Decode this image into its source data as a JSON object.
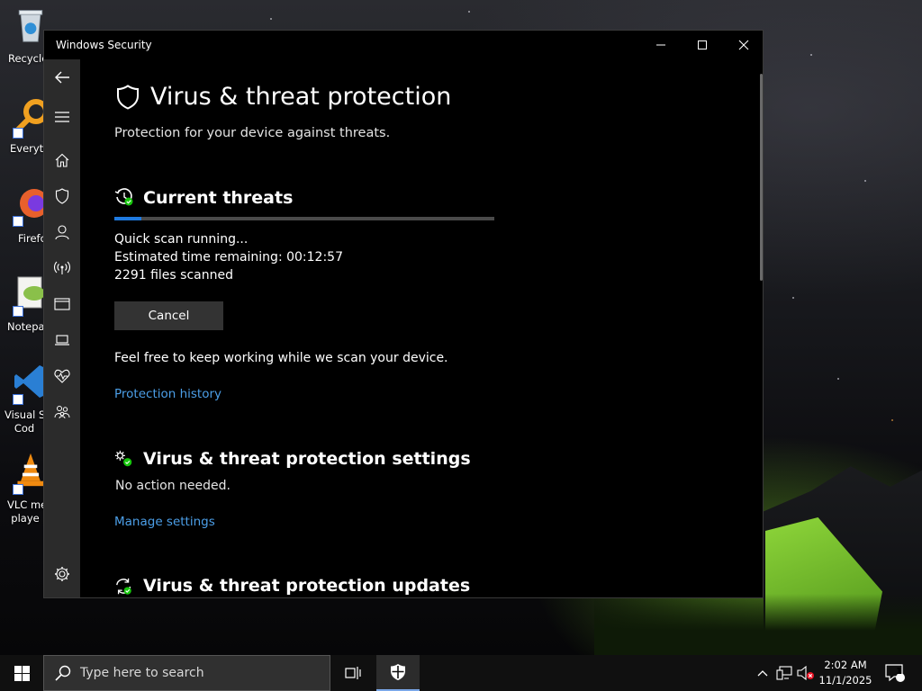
{
  "desktop": {
    "icons": [
      {
        "label": "Recycle",
        "color": "#4aa3e0"
      },
      {
        "label": "Everyth",
        "color": "#f0a020"
      },
      {
        "label": "Firefc",
        "color": "#e8602c"
      },
      {
        "label": "Notepa",
        "color": "#8ac04a"
      },
      {
        "label": "Visual St\nCod",
        "color": "#2a7fd4"
      },
      {
        "label": "VLC me\nplaye",
        "color": "#f08a10"
      }
    ]
  },
  "window": {
    "title": "Windows Security",
    "controls": {
      "minimize": "minimize-icon",
      "maximize": "maximize-icon",
      "close": "close-icon"
    }
  },
  "nav": {
    "items": [
      "back-arrow-icon",
      "hamburger-menu-icon",
      "home-icon",
      "shield-icon",
      "account-icon",
      "firewall-network-icon",
      "app-browser-control-icon",
      "device-security-icon",
      "device-health-icon",
      "family-options-icon"
    ],
    "settings": "gear-icon"
  },
  "page": {
    "title": "Virus & threat protection",
    "subtitle": "Protection for your device against threats."
  },
  "threats": {
    "title": "Current threats",
    "progress": 0.07,
    "status": "Quick scan running...",
    "eta": "Estimated time remaining: 00:12:57",
    "files": "2291 files scanned",
    "cancel_label": "Cancel",
    "note": "Feel free to keep working while we scan your device.",
    "history_link": "Protection history"
  },
  "settings_section": {
    "title": "Virus & threat protection settings",
    "status": "No action needed.",
    "link": "Manage settings"
  },
  "updates_section": {
    "title": "Virus & threat protection updates"
  },
  "taskbar": {
    "search_placeholder": "Type here to search",
    "time": "2:02 AM",
    "date": "11/1/2025",
    "notification_count": "1"
  },
  "colors": {
    "accent": "#1f7ae0",
    "link": "#4c9fe8",
    "nav_bg": "#2b2b2b",
    "check_green": "#16c60c"
  }
}
